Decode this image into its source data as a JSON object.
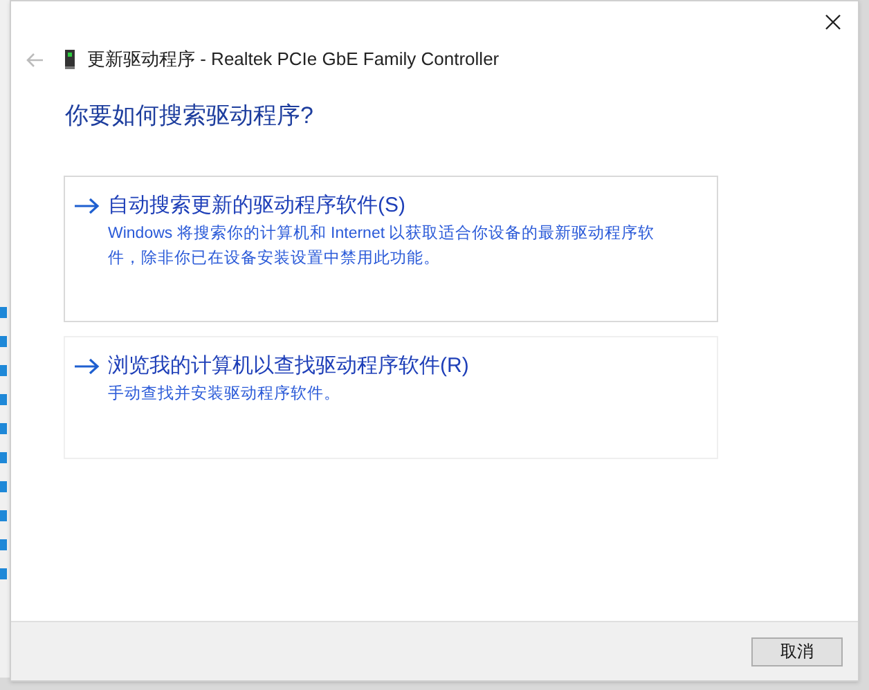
{
  "window": {
    "title": "更新驱动程序 - Realtek PCIe GbE Family Controller"
  },
  "heading": "你要如何搜索驱动程序?",
  "options": [
    {
      "title": "自动搜索更新的驱动程序软件(S)",
      "description": "Windows 将搜索你的计算机和 Internet 以获取适合你设备的最新驱动程序软件，除非你已在设备安装设置中禁用此功能。",
      "selected": true
    },
    {
      "title": "浏览我的计算机以查找驱动程序软件(R)",
      "description": "手动查找并安装驱动程序软件。",
      "selected": false
    }
  ],
  "buttons": [
    "取消"
  ]
}
